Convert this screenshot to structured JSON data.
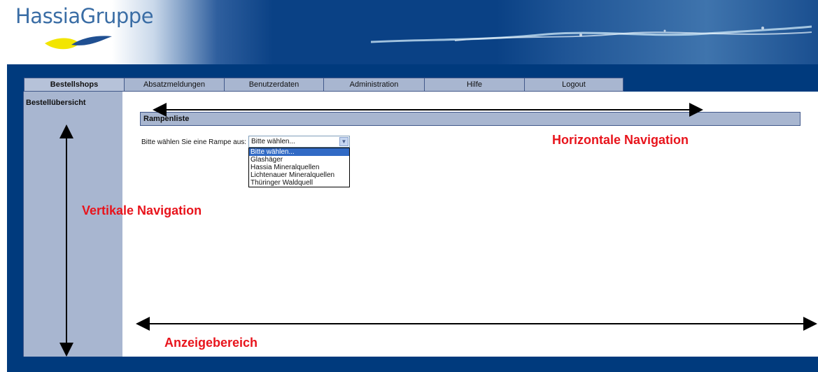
{
  "logo": {
    "text": "HassiaGruppe"
  },
  "tabs": [
    {
      "label": "Bestellshops",
      "active": true
    },
    {
      "label": "Absatzmeldungen",
      "active": false
    },
    {
      "label": "Benutzerdaten",
      "active": false
    },
    {
      "label": "Administration",
      "active": false
    },
    {
      "label": "Hilfe",
      "active": false
    },
    {
      "label": "Logout",
      "active": false
    }
  ],
  "sidebar": {
    "item": "Bestellübersicht"
  },
  "main": {
    "section_title": "Rampenliste",
    "select_label": "Bitte wählen Sie eine Rampe aus:",
    "select_value": "Bitte wählen...",
    "options": [
      "Bitte wählen...",
      "Glashäger",
      "Hassia Mineralquellen",
      "Lichtenauer Mineralquellen",
      "Thüringer Waldquell"
    ]
  },
  "annotations": {
    "horizontal": "Horizontale Navigation",
    "vertical": "Vertikale Navigation",
    "display": "Anzeigebereich"
  },
  "colors": {
    "accent": "#e8141c",
    "brand_blue": "#003a7d",
    "nav_bg": "#a8b6d0"
  }
}
